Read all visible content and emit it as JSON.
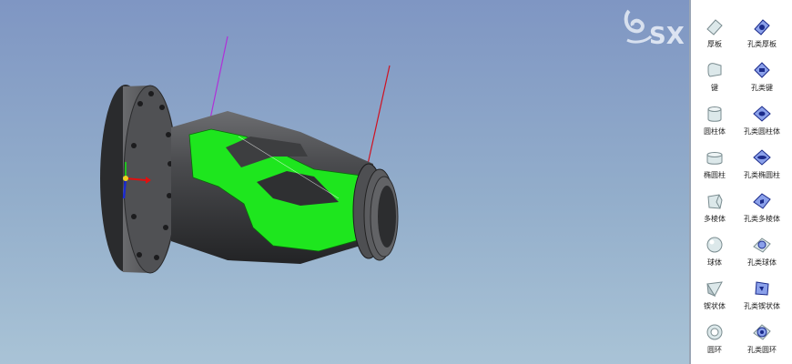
{
  "viewport": {
    "model": "cast-flange-housing",
    "colors": {
      "background_top": "#7f96c3",
      "background_bottom": "#a9c3d6",
      "body": "#3c3d3f",
      "highlight": "#1ee61e"
    }
  },
  "watermark": {
    "text": "SX",
    "color": "#e6ecf6"
  },
  "palette": {
    "top_partial": [
      "",
      ""
    ],
    "rows": [
      {
        "left": {
          "label": "厚板",
          "icon": "thick-plate-icon"
        },
        "right": {
          "label": "孔类厚板",
          "icon": "hole-thick-plate-icon"
        }
      },
      {
        "left": {
          "label": "键",
          "icon": "key-icon"
        },
        "right": {
          "label": "孔类键",
          "icon": "hole-key-icon"
        }
      },
      {
        "left": {
          "label": "圆柱体",
          "icon": "cylinder-icon"
        },
        "right": {
          "label": "孔类圆柱体",
          "icon": "hole-cylinder-icon"
        }
      },
      {
        "left": {
          "label": "椭圆柱",
          "icon": "elliptic-cylinder-icon"
        },
        "right": {
          "label": "孔类椭圆柱",
          "icon": "hole-elliptic-cylinder-icon"
        }
      },
      {
        "left": {
          "label": "多棱体",
          "icon": "polyhedron-icon"
        },
        "right": {
          "label": "孔类多棱体",
          "icon": "hole-polyhedron-icon"
        }
      },
      {
        "left": {
          "label": "球体",
          "icon": "sphere-icon"
        },
        "right": {
          "label": "孔类球体",
          "icon": "hole-sphere-icon"
        }
      },
      {
        "left": {
          "label": "锲状体",
          "icon": "wedge-icon"
        },
        "right": {
          "label": "孔类锲状体",
          "icon": "hole-wedge-icon"
        }
      },
      {
        "left": {
          "label": "圆环",
          "icon": "torus-icon"
        },
        "right": {
          "label": "孔类圆环",
          "icon": "hole-torus-icon"
        }
      }
    ]
  }
}
